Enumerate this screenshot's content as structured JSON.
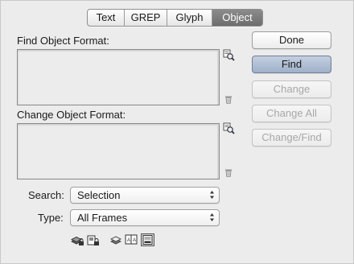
{
  "tabs": [
    {
      "label": "Text",
      "active": false
    },
    {
      "label": "GREP",
      "active": false
    },
    {
      "label": "Glyph",
      "active": false
    },
    {
      "label": "Object",
      "active": true
    }
  ],
  "find_section": {
    "label": "Find Object Format:",
    "specify_icon": "find-format-icon",
    "clear_icon": "trash-icon"
  },
  "change_section": {
    "label": "Change Object Format:",
    "specify_icon": "change-format-icon",
    "clear_icon": "trash-icon"
  },
  "buttons": {
    "done": "Done",
    "find": "Find",
    "change": "Change",
    "change_all": "Change All",
    "change_find": "Change/Find"
  },
  "search": {
    "label": "Search:",
    "value": "Selection"
  },
  "type": {
    "label": "Type:",
    "value": "All Frames"
  },
  "option_icons": [
    "include-locked-layers-icon",
    "include-locked-items-icon",
    "include-hidden-layers-icon",
    "include-master-pages-icon",
    "include-footnotes-icon"
  ],
  "colors": {
    "primary_button": "#a9b8cf",
    "active_tab": "#7a7a7a",
    "disabled_text": "#a8a8a8"
  }
}
